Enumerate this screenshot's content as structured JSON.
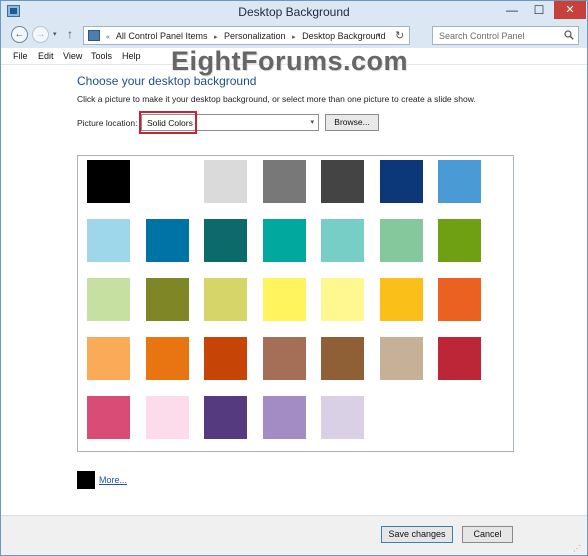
{
  "window": {
    "title": "Desktop Background",
    "minimize_glyph": "—",
    "maximize_glyph": "☐",
    "close_glyph": "✕"
  },
  "address_bar": {
    "back_icon": "←",
    "forward_icon": "→",
    "recent_icon": "▾",
    "up_icon": "↑",
    "overflow": "«",
    "breadcrumbs": [
      "All Control Panel Items",
      "Personalization",
      "Desktop Background"
    ],
    "separator": "▸",
    "dropdown_icon": "▾",
    "refresh_icon": "↻",
    "search_placeholder": "Search Control Panel"
  },
  "menu": [
    "File",
    "Edit",
    "View",
    "Tools",
    "Help"
  ],
  "watermark": "EightForums.com",
  "content": {
    "heading": "Choose your desktop background",
    "instructions": "Click a picture to make it your desktop background, or select more than one picture to create a slide show.",
    "location_label": "Picture location:",
    "location_value": "Solid Colors",
    "location_arrow": "▾",
    "browse_label": "Browse...",
    "more_label": "More..."
  },
  "colors": [
    [
      "#000000",
      "#ffffff",
      "#dadada",
      "#787878",
      "#444444",
      "#0c3779",
      "#4a9ad6"
    ],
    [
      "#9ed6ea",
      "#0073a6",
      "#0d6a6a",
      "#00a89e",
      "#77cec6",
      "#84c89b",
      "#6fa014"
    ],
    [
      "#c5e0a0",
      "#7f8625",
      "#d6d56a",
      "#fff45e",
      "#fff890",
      "#fbbf19",
      "#eb6122"
    ],
    [
      "#fbab57",
      "#e87511",
      "#c74407",
      "#a56e57",
      "#8f5f35",
      "#c6b097",
      "#bc2637"
    ],
    [
      "#d94c76",
      "#fcdbea",
      "#553a80",
      "#a28cc3",
      "#d9d0e6"
    ]
  ],
  "more_color": "#000000",
  "footer": {
    "save_label": "Save changes",
    "cancel_label": "Cancel"
  }
}
